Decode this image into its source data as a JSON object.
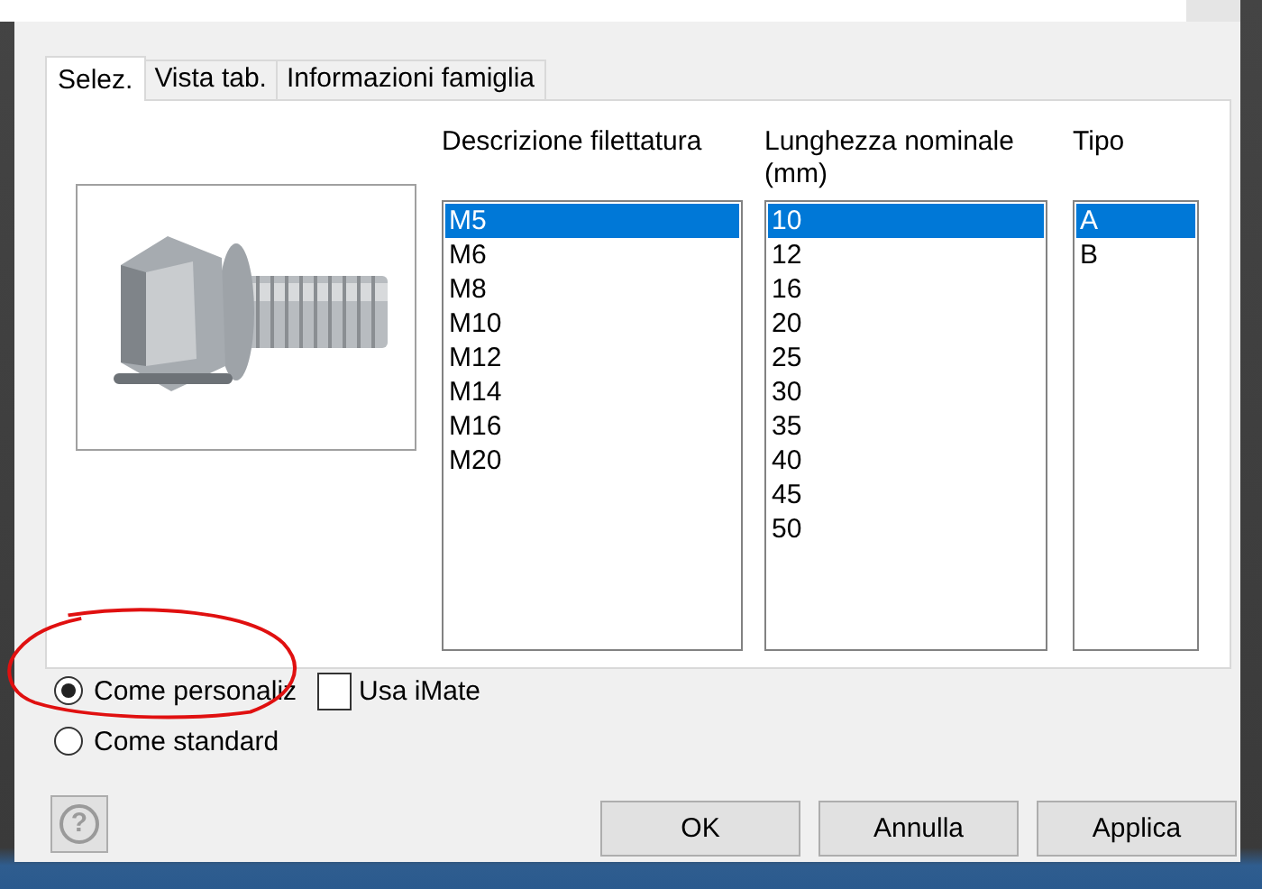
{
  "tabs": [
    {
      "label": "Selez.",
      "selected": true
    },
    {
      "label": "Vista tab.",
      "selected": false
    },
    {
      "label": "Informazioni famiglia",
      "selected": false
    }
  ],
  "lists": [
    {
      "heading": "Descrizione filettatura",
      "items": [
        {
          "label": "M5",
          "selected": true
        },
        {
          "label": "M6",
          "selected": false
        },
        {
          "label": "M8",
          "selected": false
        },
        {
          "label": "M10",
          "selected": false
        },
        {
          "label": "M12",
          "selected": false
        },
        {
          "label": "M14",
          "selected": false
        },
        {
          "label": "M16",
          "selected": false
        },
        {
          "label": "M20",
          "selected": false
        }
      ]
    },
    {
      "heading": "Lunghezza nominale (mm)",
      "items": [
        {
          "label": "10",
          "selected": true
        },
        {
          "label": "12",
          "selected": false
        },
        {
          "label": "16",
          "selected": false
        },
        {
          "label": "20",
          "selected": false
        },
        {
          "label": "25",
          "selected": false
        },
        {
          "label": "30",
          "selected": false
        },
        {
          "label": "35",
          "selected": false
        },
        {
          "label": "40",
          "selected": false
        },
        {
          "label": "45",
          "selected": false
        },
        {
          "label": "50",
          "selected": false
        }
      ]
    },
    {
      "heading": "Tipo",
      "items": [
        {
          "label": "A",
          "selected": true
        },
        {
          "label": "B",
          "selected": false
        }
      ]
    }
  ],
  "options": [
    {
      "kind": "radio",
      "label": "Come personaliz",
      "selected": true
    },
    {
      "kind": "radio",
      "label": "Come standard",
      "selected": false
    }
  ],
  "checkbox": {
    "label": "Usa iMate",
    "checked": false
  },
  "help_button": {
    "icon": "?"
  },
  "buttons": [
    "OK",
    "Annulla",
    "Applica"
  ]
}
